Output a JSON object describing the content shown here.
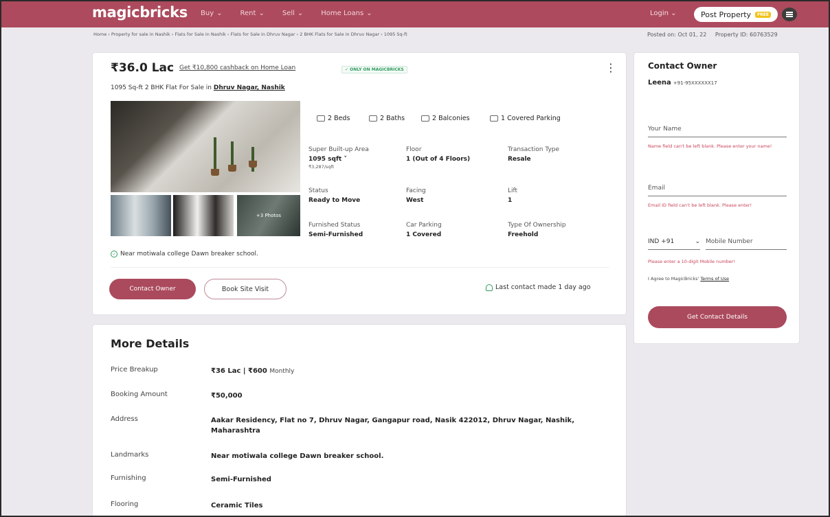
{
  "nav": {
    "logo": "magicbricks",
    "menu": [
      "Buy",
      "Rent",
      "Sell",
      "Home Loans"
    ],
    "login": "Login",
    "post_property": "Post Property",
    "free_badge": "FREE"
  },
  "breadcrumb": "Home › Property for sale in Nashik › Flats for Sale in Nashik › Flats for Sale in Dhruv Nagar › 2 BHK Flats for Sale in Dhruv Nagar › 1095 Sq-ft",
  "meta": {
    "posted_on": "Posted on: Oct 01, 22",
    "property_id": "Property ID: 60763529"
  },
  "listing": {
    "price": "₹36.0 Lac",
    "cashback": "Get ₹10,800 cashback on Home Loan",
    "only_badge": "✓ ONLY ON MAGICBRICKS",
    "subtitle_prefix": "1095 Sq-ft 2 BHK Flat For Sale in",
    "location": "Dhruv Nagar, Nashik",
    "more_photos": "+3 Photos",
    "amenities": [
      "2 Beds",
      "2 Baths",
      "2 Balconies",
      "1 Covered Parking"
    ],
    "specs": [
      {
        "label": "Super Built-up Area",
        "value": "1095 sqft ˅",
        "sub": "₹3,287/sqft"
      },
      {
        "label": "Floor",
        "value": "1 (Out of 4 Floors)",
        "sub": ""
      },
      {
        "label": "Transaction Type",
        "value": "Resale",
        "sub": ""
      },
      {
        "label": "Status",
        "value": "Ready to Move",
        "sub": ""
      },
      {
        "label": "Facing",
        "value": "West",
        "sub": ""
      },
      {
        "label": "Lift",
        "value": "1",
        "sub": ""
      },
      {
        "label": "Furnished Status",
        "value": "Semi-Furnished",
        "sub": ""
      },
      {
        "label": "Car Parking",
        "value": "1 Covered",
        "sub": ""
      },
      {
        "label": "Type Of Ownership",
        "value": "Freehold",
        "sub": ""
      }
    ],
    "landmark_note": "Near motiwala college Dawn breaker school.",
    "contact_owner_btn": "Contact Owner",
    "book_visit_btn": "Book Site Visit",
    "last_contact": "Last contact made 1 day ago"
  },
  "more_details": {
    "title": "More Details",
    "rows": [
      {
        "key": "Price Breakup",
        "value": "₹36 Lac | ₹600",
        "extra": "Monthly"
      },
      {
        "key": "Booking Amount",
        "value": "₹50,000",
        "extra": ""
      },
      {
        "key": "Address",
        "value": "Aakar Residency, Flat no 7, Dhruv Nagar, Gangapur road, Nasik 422012, Dhruv Nagar, Nashik, Maharashtra",
        "extra": ""
      },
      {
        "key": "Landmarks",
        "value": "Near motiwala college Dawn breaker school.",
        "extra": ""
      },
      {
        "key": "Furnishing",
        "value": "Semi-Furnished",
        "extra": ""
      },
      {
        "key": "Flooring",
        "value": "Ceramic Tiles",
        "extra": ""
      }
    ]
  },
  "contact_form": {
    "title": "Contact Owner",
    "owner_name": "Leena",
    "owner_phone": "+91-95XXXXXX17",
    "name_placeholder": "Your Name",
    "name_error": "Name field can't be left blank. Please enter your name!",
    "email_placeholder": "Email",
    "email_error": "Email ID field can't be left blank. Please enter!",
    "country_code": "IND +91",
    "mobile_placeholder": "Mobile Number",
    "mobile_error": "Please enter a 10-digit Mobile number!",
    "agree_text": "I Agree to MagicBricks'",
    "terms_link": "Terms of Use",
    "submit": "Get Contact Details"
  },
  "colors": {
    "brand": "#ad4a5d",
    "button": "#ab4a5d",
    "error": "#c8435a",
    "success": "#2f9b5d"
  }
}
